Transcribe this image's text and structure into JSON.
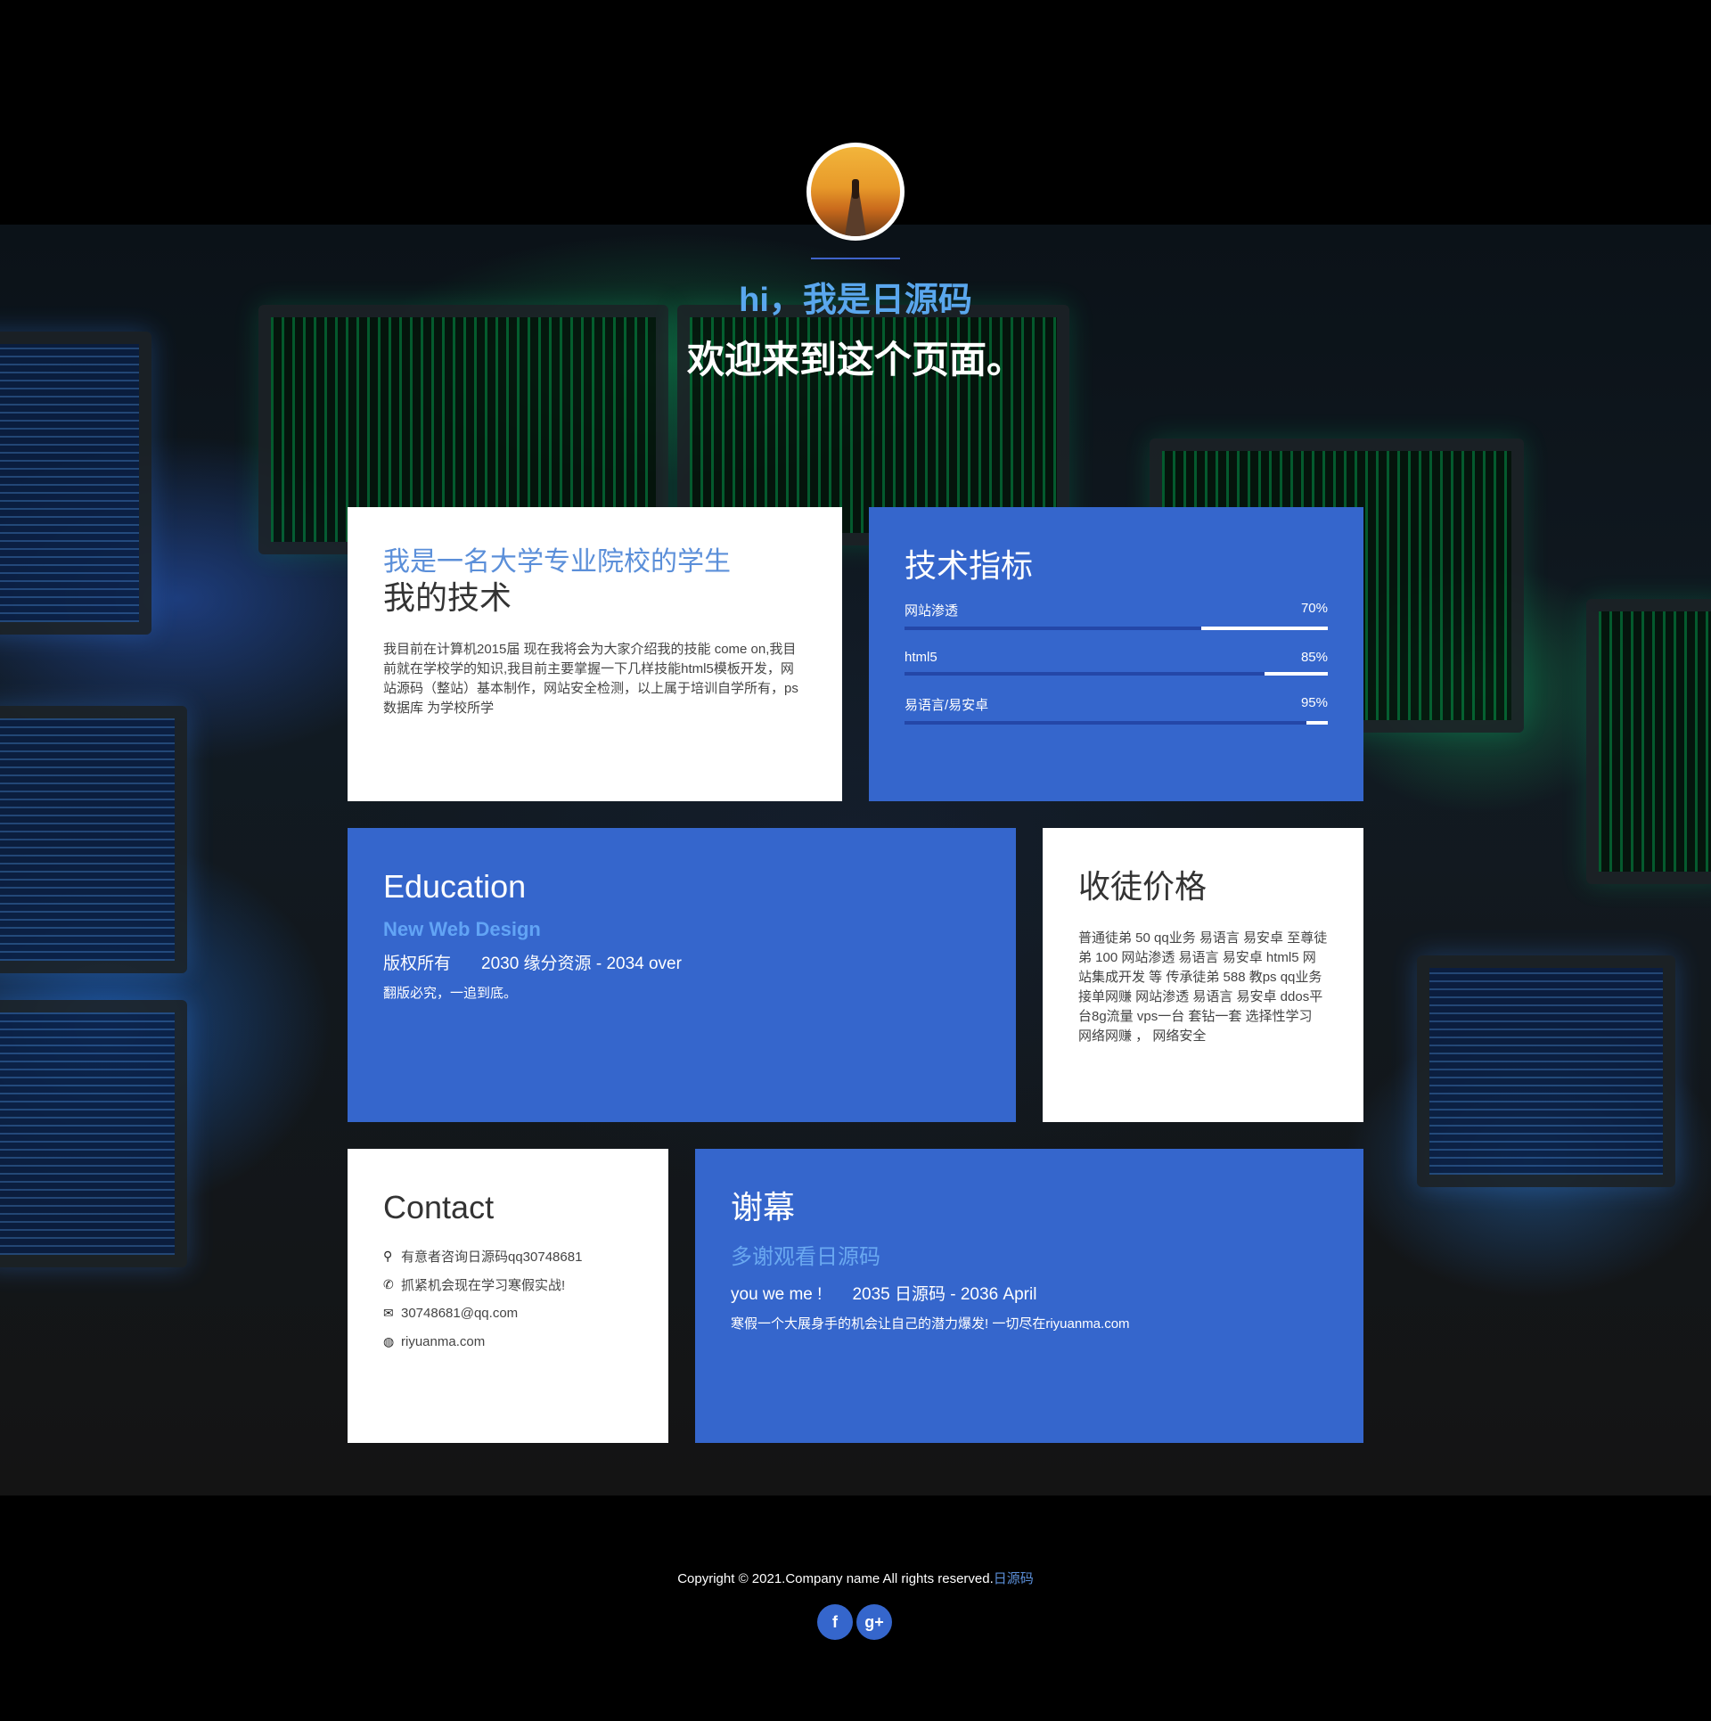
{
  "header": {
    "subtitle": "hi，我是日源码",
    "title": "欢迎来到这个页面。"
  },
  "about": {
    "accent": "我是一名大学专业院校的学生",
    "title": "我的技术",
    "body": "我目前在计算机2015届 现在我将会为大家介绍我的技能 come on,我目前就在学校学的知识,我目前主要掌握一下几样技能html5模板开发，网站源码（整站）基本制作，网站安全检测，以上属于培训自学所有，ps 数据库 为学校所学"
  },
  "skills": {
    "title": "技术指标",
    "items": [
      {
        "label": "网站渗透",
        "percent_label": "70%",
        "percent": 70
      },
      {
        "label": "html5",
        "percent_label": "85%",
        "percent": 85
      },
      {
        "label": "易语言/易安卓",
        "percent_label": "95%",
        "percent": 95
      }
    ]
  },
  "education": {
    "title": "Education",
    "accent": "New Web Design",
    "line_left": "版权所有",
    "line_right": "2030 缘分资源 - 2034 over",
    "note": "翻版必究，一追到底。"
  },
  "price": {
    "title": "收徒价格",
    "body": "普通徒弟 50 qq业务 易语言 易安卓 至尊徒弟 100 网站渗透 易语言 易安卓 html5 网站集成开发 等 传承徒弟 588 教ps qq业务接单网赚 网站渗透 易语言 易安卓 ddos平台8g流量 vps一台 套钻一套 选择性学习 网络网赚 ， 网络安全"
  },
  "contact": {
    "title": "Contact",
    "items": [
      {
        "icon": "map-marker-icon",
        "glyph": "⚲",
        "text": "有意者咨询日源码qq30748681"
      },
      {
        "icon": "phone-icon",
        "glyph": "✆",
        "text": "抓紧机会现在学习寒假实战!"
      },
      {
        "icon": "envelope-icon",
        "glyph": "✉",
        "text": "30748681@qq.com"
      },
      {
        "icon": "globe-icon",
        "glyph": "◍",
        "text": "riyuanma.com"
      }
    ]
  },
  "thanks": {
    "title": "谢幕",
    "accent": "多谢观看日源码",
    "line_left": "you we me !",
    "line_right": "2035 日源码 - 2036 April",
    "note": "寒假一个大展身手的机会让自己的潜力爆发! 一切尽在riyuanma.com"
  },
  "footer": {
    "copyright": "Copyright © 2021.Company name All rights reserved.",
    "link": "日源码",
    "social": [
      {
        "name": "facebook-icon",
        "glyph": "f"
      },
      {
        "name": "google-plus-icon",
        "glyph": "g+"
      }
    ]
  },
  "colors": {
    "blue_card": "#3566cc",
    "accent_text": "#5b8fd9",
    "bar_track": "#2447a8"
  }
}
